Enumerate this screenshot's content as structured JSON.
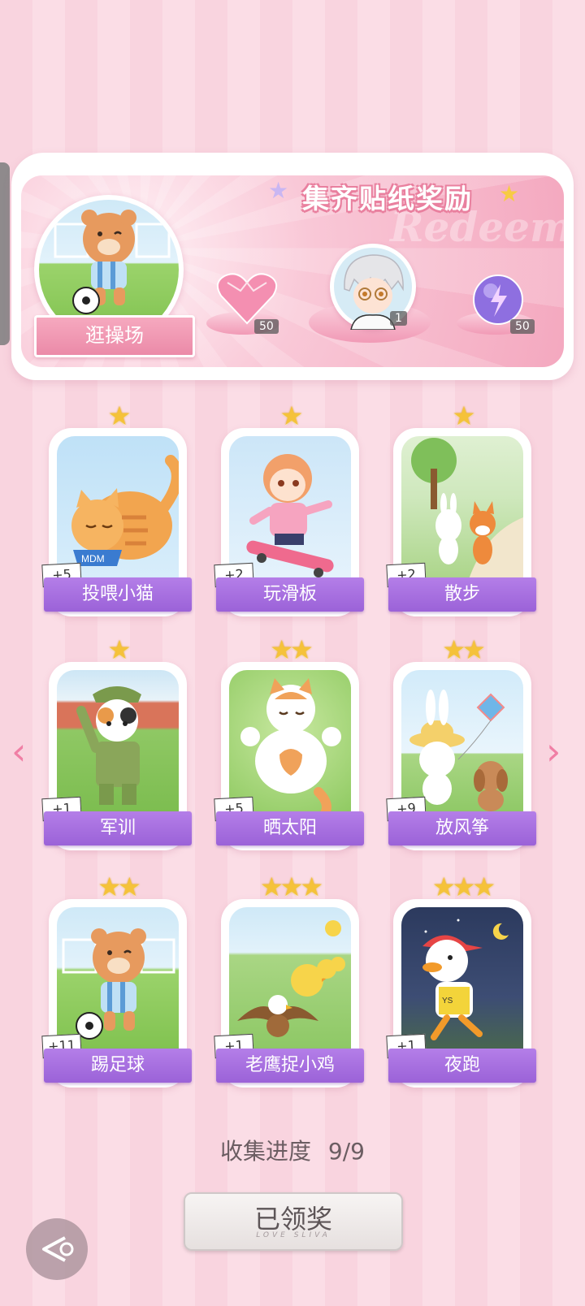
{
  "banner": {
    "title": "集齐贴纸奖励",
    "bg_word": "Redeem",
    "venue_label": "逛操场",
    "rewards": [
      {
        "icon": "pink-heart-gem-icon",
        "count": "50"
      },
      {
        "icon": "character-avatar-icon",
        "count": "1"
      },
      {
        "icon": "purple-energy-orb-icon",
        "count": "50"
      }
    ]
  },
  "cards": [
    {
      "label": "投喂小猫",
      "count": "+5",
      "stars": "★",
      "icon": "orange-cat-eating-icon"
    },
    {
      "label": "玩滑板",
      "count": "+2",
      "stars": "★",
      "icon": "girl-skateboard-icon"
    },
    {
      "label": "散步",
      "count": "+2",
      "stars": "★",
      "icon": "bunny-fox-walk-icon"
    },
    {
      "label": "军训",
      "count": "+1",
      "stars": "★",
      "icon": "cat-soldier-icon"
    },
    {
      "label": "晒太阳",
      "count": "+5",
      "stars": "★★",
      "icon": "cat-sunbathing-icon"
    },
    {
      "label": "放风筝",
      "count": "+9",
      "stars": "★★",
      "icon": "bunny-kite-icon"
    },
    {
      "label": "踢足球",
      "count": "+11",
      "stars": "★★",
      "icon": "bear-soccer-icon"
    },
    {
      "label": "老鹰捉小鸡",
      "count": "+1",
      "stars": "★★★",
      "icon": "eagle-chicks-icon"
    },
    {
      "label": "夜跑",
      "count": "+1",
      "stars": "★★★",
      "icon": "duck-night-run-icon"
    }
  ],
  "progress": {
    "label": "收集进度",
    "value": "9/9"
  },
  "claim_button": {
    "label": "已领奖",
    "sub": "LOVE SLIVA"
  },
  "colors": {
    "accent_pink": "#f07fa5",
    "label_purple": "#9b62d8",
    "star_gold": "#f5c23a"
  }
}
